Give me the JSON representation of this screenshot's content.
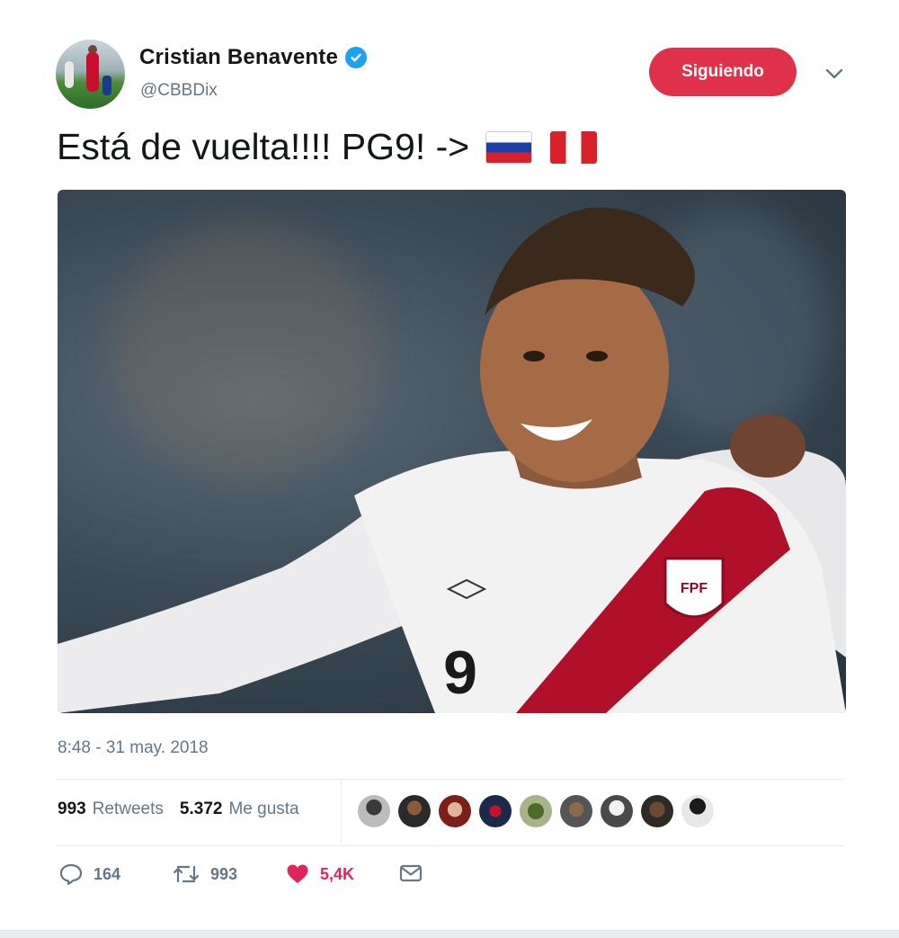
{
  "user": {
    "name": "Cristian Benavente",
    "handle": "@CBBDix",
    "follow_label": "Siguiendo"
  },
  "tweet": {
    "text": "Está de vuelta!!!! PG9! ->",
    "flags": [
      "russia-flag",
      "peru-flag"
    ],
    "timestamp": "8:48 - 31 may. 2018"
  },
  "stats": {
    "retweets_count": "993",
    "retweets_label": "Retweets",
    "likes_count": "5.372",
    "likes_label": "Me gusta"
  },
  "actions": {
    "reply_count": "164",
    "retweet_count": "993",
    "like_count": "5,4K"
  },
  "colors": {
    "follow_button": "#e0314b",
    "verified": "#1da1f2",
    "like_active": "#e0245e",
    "muted_text": "#657786"
  }
}
